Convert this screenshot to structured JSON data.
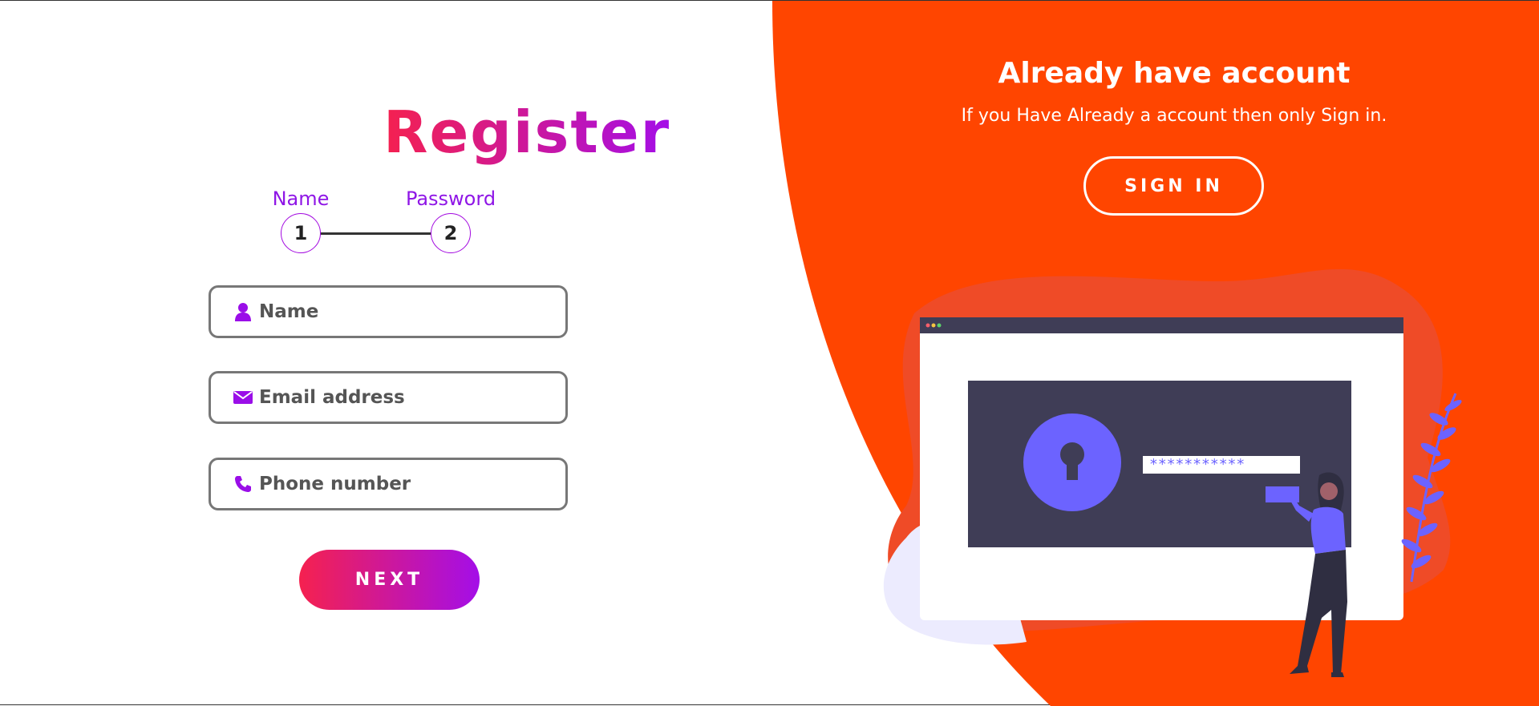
{
  "register": {
    "title": "Register",
    "steps": [
      {
        "label": "Name",
        "number": "1"
      },
      {
        "label": "Password",
        "number": "2"
      }
    ],
    "fields": {
      "name": {
        "placeholder": "Name",
        "icon": "user-icon"
      },
      "email": {
        "placeholder": "Email address",
        "icon": "envelope-icon"
      },
      "phone": {
        "placeholder": "Phone number",
        "icon": "phone-icon"
      }
    },
    "next_label": "NEXT"
  },
  "side_panel": {
    "title": "Already have account",
    "subtitle": "If you Have Already a account then only Sign in.",
    "signin_label": "SIGN IN",
    "illustration": {
      "password_mask": "***********"
    }
  },
  "colors": {
    "accent_orange": "#ff4500",
    "gradient_start": "#f5214f",
    "gradient_end": "#a40ee8",
    "illustration_purple": "#6c63ff",
    "illustration_dark": "#3f3d56"
  }
}
